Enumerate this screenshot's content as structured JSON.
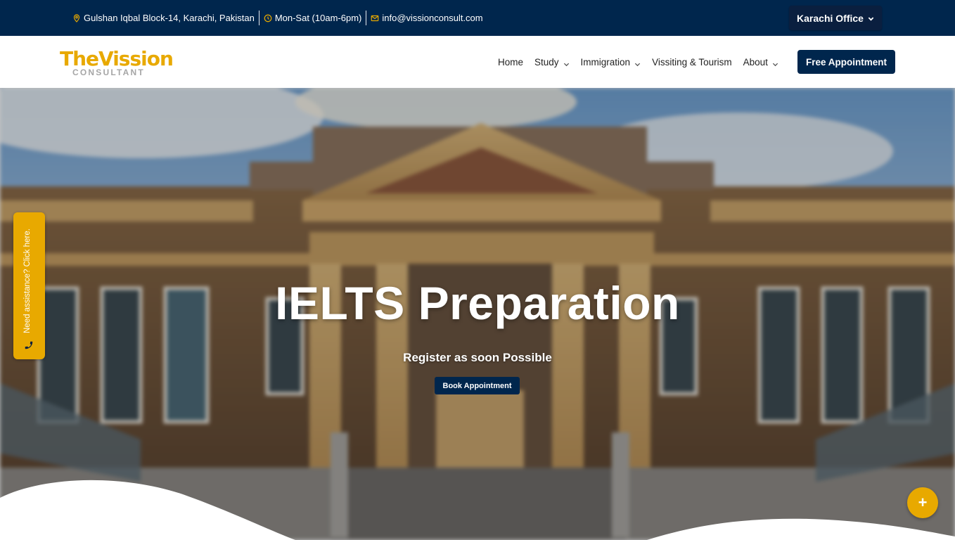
{
  "topbar": {
    "address": "Gulshan Iqbal Block-14, Karachi, Pakistan",
    "hours": "Mon-Sat (10am-6pm)",
    "email": "info@vissionconsult.com",
    "office_button": "Karachi Office",
    "icons": [
      "map-pin-icon",
      "clock-icon",
      "mail-icon"
    ]
  },
  "logo": {
    "main": "TheVission",
    "sub": "CONSULTANT"
  },
  "nav": {
    "items": [
      {
        "label": "Home",
        "has_dropdown": false
      },
      {
        "label": "Study",
        "has_dropdown": true
      },
      {
        "label": "Immigration",
        "has_dropdown": true
      },
      {
        "label": "Vissiting & Tourism",
        "has_dropdown": false
      },
      {
        "label": "About",
        "has_dropdown": true
      }
    ],
    "cta": "Free Appointment"
  },
  "hero": {
    "title": "IELTS Preparation",
    "subtitle": "Register as soon Possible",
    "button": "Book Appointment"
  },
  "help_tab": {
    "label": "Need assistance? Click here."
  },
  "fab": {
    "symbol": "+"
  },
  "colors": {
    "navy": "#00264d",
    "gold": "#e8a900"
  }
}
